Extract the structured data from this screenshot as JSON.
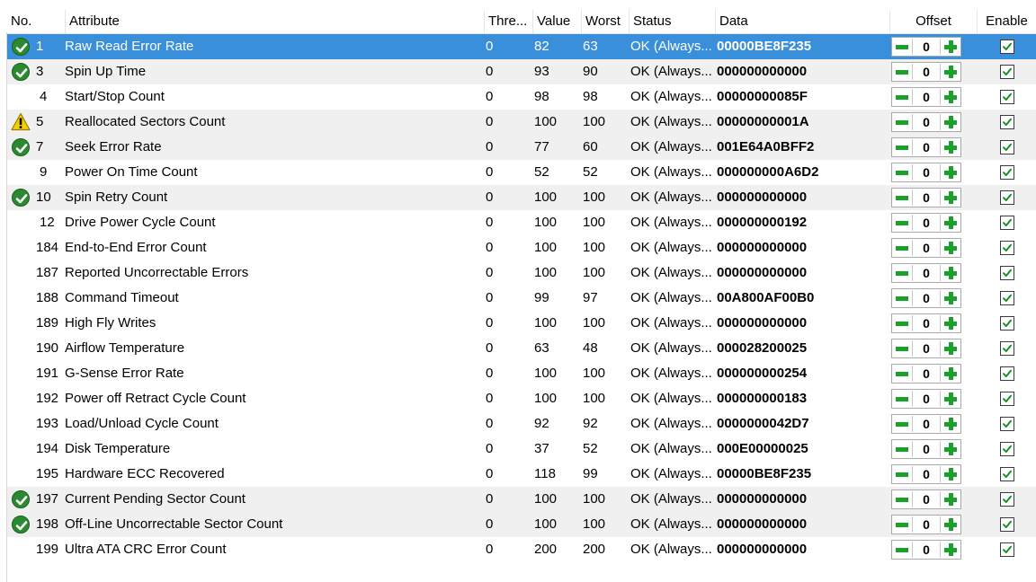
{
  "columns": {
    "no": "No.",
    "attribute": "Attribute",
    "threshold": "Thre...",
    "value": "Value",
    "worst": "Worst",
    "status": "Status",
    "data": "Data",
    "offset": "Offset",
    "enable": "Enable"
  },
  "colors": {
    "selection": "#3a8fdb",
    "alt_row": "#f0f0f0",
    "ok_icon": "#2b8a2f",
    "warn_icon": "#f5d000",
    "stepper_green": "#1aa12a"
  },
  "rows": [
    {
      "icon": "ok",
      "no": "1",
      "attribute": "Raw Read Error Rate",
      "threshold": "0",
      "value": "82",
      "worst": "63",
      "status": "OK (Always...",
      "data": "00000BE8F235",
      "offset": "0",
      "enabled": true,
      "selected": true,
      "alt": true
    },
    {
      "icon": "ok",
      "no": "3",
      "attribute": "Spin Up Time",
      "threshold": "0",
      "value": "93",
      "worst": "90",
      "status": "OK (Always...",
      "data": "000000000000",
      "offset": "0",
      "enabled": true,
      "selected": false,
      "alt": true
    },
    {
      "icon": "",
      "no": "4",
      "attribute": "Start/Stop Count",
      "threshold": "0",
      "value": "98",
      "worst": "98",
      "status": "OK (Always...",
      "data": "00000000085F",
      "offset": "0",
      "enabled": true,
      "selected": false,
      "alt": false
    },
    {
      "icon": "warn",
      "no": "5",
      "attribute": "Reallocated Sectors Count",
      "threshold": "0",
      "value": "100",
      "worst": "100",
      "status": "OK (Always...",
      "data": "00000000001A",
      "offset": "0",
      "enabled": true,
      "selected": false,
      "alt": true
    },
    {
      "icon": "ok",
      "no": "7",
      "attribute": "Seek Error Rate",
      "threshold": "0",
      "value": "77",
      "worst": "60",
      "status": "OK (Always...",
      "data": "001E64A0BFF2",
      "offset": "0",
      "enabled": true,
      "selected": false,
      "alt": true
    },
    {
      "icon": "",
      "no": "9",
      "attribute": "Power On Time Count",
      "threshold": "0",
      "value": "52",
      "worst": "52",
      "status": "OK (Always...",
      "data": "000000000A6D2",
      "offset": "0",
      "enabled": true,
      "selected": false,
      "alt": false
    },
    {
      "icon": "ok",
      "no": "10",
      "attribute": "Spin Retry Count",
      "threshold": "0",
      "value": "100",
      "worst": "100",
      "status": "OK (Always...",
      "data": "000000000000",
      "offset": "0",
      "enabled": true,
      "selected": false,
      "alt": true
    },
    {
      "icon": "",
      "no": "12",
      "attribute": "Drive Power Cycle Count",
      "threshold": "0",
      "value": "100",
      "worst": "100",
      "status": "OK (Always...",
      "data": "000000000192",
      "offset": "0",
      "enabled": true,
      "selected": false,
      "alt": false
    },
    {
      "icon": "",
      "no": "184",
      "attribute": "End-to-End Error Count",
      "threshold": "0",
      "value": "100",
      "worst": "100",
      "status": "OK (Always...",
      "data": "000000000000",
      "offset": "0",
      "enabled": true,
      "selected": false,
      "alt": false
    },
    {
      "icon": "",
      "no": "187",
      "attribute": "Reported Uncorrectable Errors",
      "threshold": "0",
      "value": "100",
      "worst": "100",
      "status": "OK (Always...",
      "data": "000000000000",
      "offset": "0",
      "enabled": true,
      "selected": false,
      "alt": false
    },
    {
      "icon": "",
      "no": "188",
      "attribute": "Command Timeout",
      "threshold": "0",
      "value": "99",
      "worst": "97",
      "status": "OK (Always...",
      "data": "00A800AF00B0",
      "offset": "0",
      "enabled": true,
      "selected": false,
      "alt": false
    },
    {
      "icon": "",
      "no": "189",
      "attribute": "High Fly Writes",
      "threshold": "0",
      "value": "100",
      "worst": "100",
      "status": "OK (Always...",
      "data": "000000000000",
      "offset": "0",
      "enabled": true,
      "selected": false,
      "alt": false
    },
    {
      "icon": "",
      "no": "190",
      "attribute": "Airflow Temperature",
      "threshold": "0",
      "value": "63",
      "worst": "48",
      "status": "OK (Always...",
      "data": "000028200025",
      "offset": "0",
      "enabled": true,
      "selected": false,
      "alt": false
    },
    {
      "icon": "",
      "no": "191",
      "attribute": "G-Sense Error Rate",
      "threshold": "0",
      "value": "100",
      "worst": "100",
      "status": "OK (Always...",
      "data": "000000000254",
      "offset": "0",
      "enabled": true,
      "selected": false,
      "alt": false
    },
    {
      "icon": "",
      "no": "192",
      "attribute": "Power off Retract Cycle Count",
      "threshold": "0",
      "value": "100",
      "worst": "100",
      "status": "OK (Always...",
      "data": "000000000183",
      "offset": "0",
      "enabled": true,
      "selected": false,
      "alt": false
    },
    {
      "icon": "",
      "no": "193",
      "attribute": "Load/Unload Cycle Count",
      "threshold": "0",
      "value": "92",
      "worst": "92",
      "status": "OK (Always...",
      "data": "0000000042D7",
      "offset": "0",
      "enabled": true,
      "selected": false,
      "alt": false
    },
    {
      "icon": "",
      "no": "194",
      "attribute": "Disk Temperature",
      "threshold": "0",
      "value": "37",
      "worst": "52",
      "status": "OK (Always...",
      "data": "000E00000025",
      "offset": "0",
      "enabled": true,
      "selected": false,
      "alt": false
    },
    {
      "icon": "",
      "no": "195",
      "attribute": "Hardware ECC Recovered",
      "threshold": "0",
      "value": "118",
      "worst": "99",
      "status": "OK (Always...",
      "data": "00000BE8F235",
      "offset": "0",
      "enabled": true,
      "selected": false,
      "alt": false
    },
    {
      "icon": "ok",
      "no": "197",
      "attribute": "Current Pending Sector Count",
      "threshold": "0",
      "value": "100",
      "worst": "100",
      "status": "OK (Always...",
      "data": "000000000000",
      "offset": "0",
      "enabled": true,
      "selected": false,
      "alt": true
    },
    {
      "icon": "ok",
      "no": "198",
      "attribute": "Off-Line Uncorrectable Sector Count",
      "threshold": "0",
      "value": "100",
      "worst": "100",
      "status": "OK (Always...",
      "data": "000000000000",
      "offset": "0",
      "enabled": true,
      "selected": false,
      "alt": true
    },
    {
      "icon": "",
      "no": "199",
      "attribute": "Ultra ATA CRC Error Count",
      "threshold": "0",
      "value": "200",
      "worst": "200",
      "status": "OK (Always...",
      "data": "000000000000",
      "offset": "0",
      "enabled": true,
      "selected": false,
      "alt": false
    }
  ]
}
